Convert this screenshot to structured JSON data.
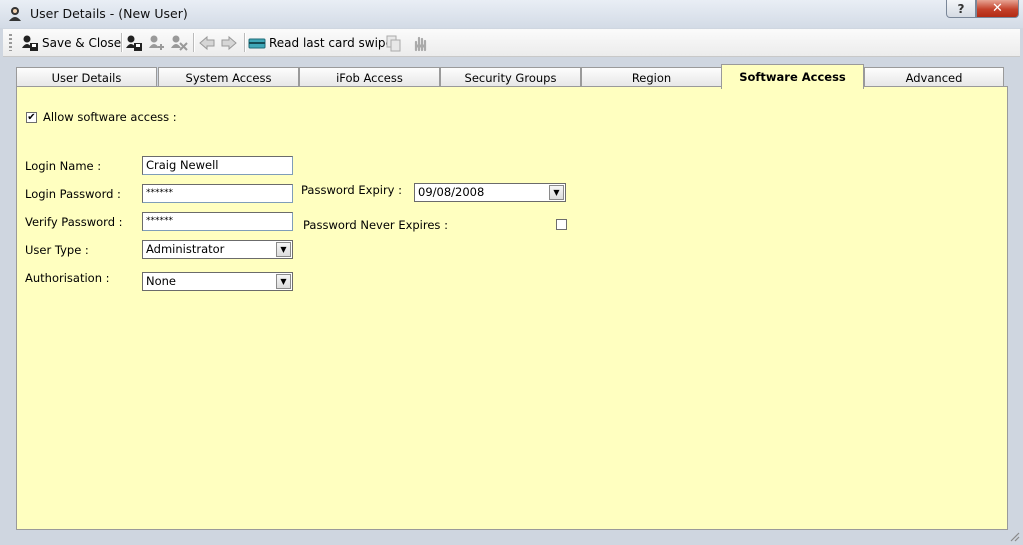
{
  "window": {
    "title": "User Details - (New User)",
    "help_label": "?",
    "close_label": "✕"
  },
  "toolbar": {
    "save_close_label": "Save & Close",
    "read_card_label": "Read last card swipe",
    "icons": [
      "save-close-icon",
      "save-new-icon",
      "add-user-icon",
      "delete-user-icon",
      "back-icon",
      "forward-icon",
      "card-reader-icon",
      "copy-icon",
      "hand-icon"
    ]
  },
  "tabs": [
    {
      "label": "User Details",
      "active": false
    },
    {
      "label": "System Access",
      "active": false
    },
    {
      "label": "iFob Access",
      "active": false
    },
    {
      "label": "Security Groups",
      "active": false
    },
    {
      "label": "Region",
      "active": false
    },
    {
      "label": "Software Access",
      "active": true
    },
    {
      "label": "Advanced",
      "active": false
    }
  ],
  "form": {
    "allow_software_access": {
      "label": "Allow software access :",
      "checked": true,
      "mark": "✔"
    },
    "login_name": {
      "label": "Login Name :",
      "value": "Craig Newell"
    },
    "login_password": {
      "label": "Login Password :",
      "value": "******"
    },
    "verify_password": {
      "label": "Verify Password :",
      "value": "******"
    },
    "user_type": {
      "label": "User Type :",
      "value": "Administrator"
    },
    "authorisation": {
      "label": "Authorisation :",
      "value": "None"
    },
    "password_expiry": {
      "label": "Password Expiry :",
      "value": "09/08/2008"
    },
    "password_never_expires": {
      "label": "Password Never Expires :",
      "checked": false
    }
  },
  "colors": {
    "panel_bg": "#ffffc0",
    "close_button": "#c4412a",
    "titlebar": "#d3dbe6"
  }
}
